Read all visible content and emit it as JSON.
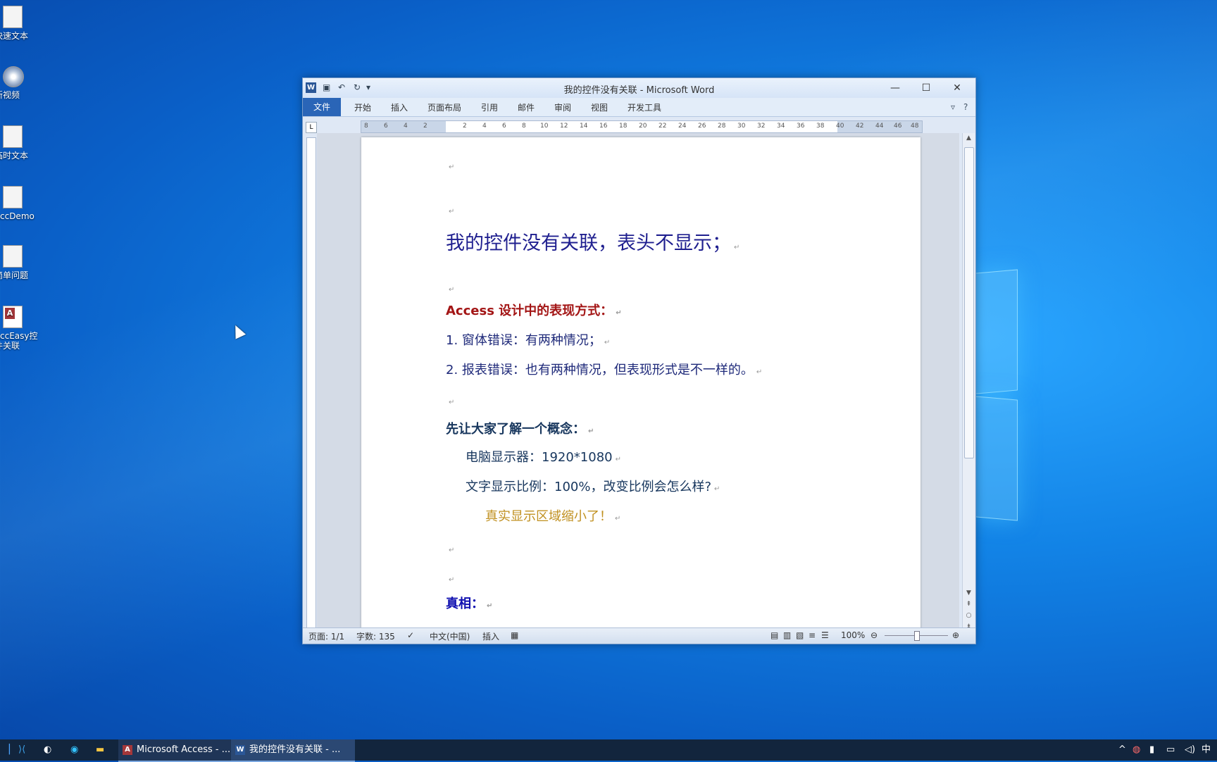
{
  "desktop": {
    "icons": [
      {
        "label": "快速文本",
        "kind": "file"
      },
      {
        "label": "新视频",
        "kind": "disc"
      },
      {
        "label": "临时文本",
        "kind": "file"
      },
      {
        "label": "AccDemo",
        "kind": "file"
      },
      {
        "label": "简单问题",
        "kind": "file"
      },
      {
        "label": "AccEasy控件关联",
        "kind": "access"
      }
    ]
  },
  "word": {
    "title": "我的控件没有关联 - Microsoft Word",
    "tabs": [
      "文件",
      "开始",
      "插入",
      "页面布局",
      "引用",
      "邮件",
      "审阅",
      "视图",
      "开发工具"
    ],
    "ruler_numbers": [
      "8",
      "6",
      "4",
      "2",
      "2",
      "4",
      "6",
      "8",
      "10",
      "12",
      "14",
      "16",
      "18",
      "20",
      "22",
      "24",
      "26",
      "28",
      "30",
      "32",
      "34",
      "36",
      "38",
      "40",
      "42",
      "44",
      "46",
      "48"
    ],
    "document": {
      "title": "我的控件没有关联，表头不显示；",
      "section1": "Access 设计中的表现方式：",
      "item1": "1. 窗体错误：有两种情况；",
      "item2": "2. 报表错误：也有两种情况，但表现形式是不一样的。",
      "section2": "先让大家了解一个概念：",
      "line1": "电脑显示器：1920*1080",
      "line2": "文字显示比例：100%，改变比例会怎么样?",
      "line3": "真实显示区域缩小了！",
      "section3": "真相：",
      "para_mark": "↵"
    },
    "status": {
      "page": "页面: 1/1",
      "words": "字数: 135",
      "lang": "中文(中国)",
      "mode": "插入",
      "zoom": "100%"
    }
  },
  "taskbar": {
    "apps": [
      {
        "label": "Microsoft Access - ...",
        "icon": "A",
        "color": "#a4373a"
      },
      {
        "label": "我的控件没有关联 - ...",
        "icon": "W",
        "color": "#2b5797"
      }
    ],
    "ime": "中"
  }
}
